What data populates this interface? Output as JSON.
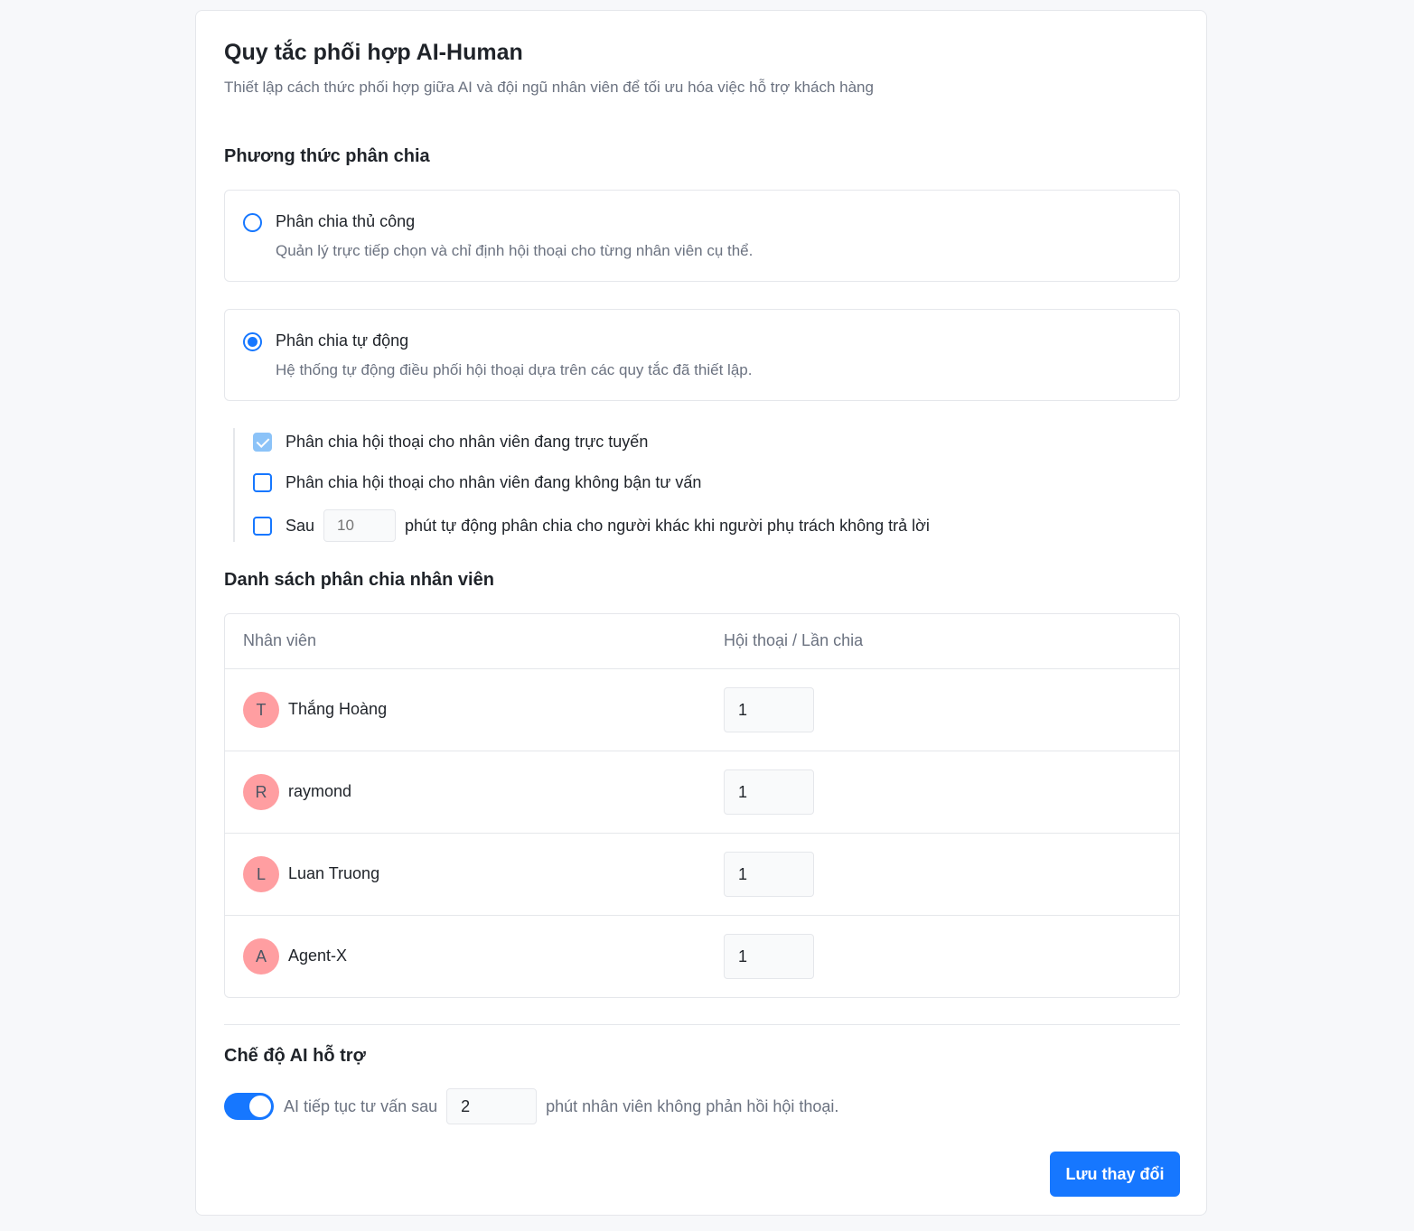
{
  "header": {
    "title": "Quy tắc phối hợp AI-Human",
    "subtitle": "Thiết lập cách thức phối hợp giữa AI và đội ngũ nhân viên để tối ưu hóa việc hỗ trợ khách hàng"
  },
  "distribution": {
    "section_title": "Phương thức phân chia",
    "options": [
      {
        "label": "Phân chia thủ công",
        "description": "Quản lý trực tiếp chọn và chỉ định hội thoại cho từng nhân viên cụ thể.",
        "selected": false
      },
      {
        "label": "Phân chia tự động",
        "description": "Hệ thống tự động điều phối hội thoại dựa trên các quy tắc đã thiết lập.",
        "selected": true
      }
    ],
    "auto_rules": [
      {
        "label": "Phân chia hội thoại cho nhân viên đang trực tuyến",
        "checked": true
      },
      {
        "label": "Phân chia hội thoại cho nhân viên đang không bận tư vấn",
        "checked": false
      }
    ],
    "timeout_rule": {
      "prefix": "Sau",
      "placeholder": "10",
      "suffix": "phút tự động phân chia cho người khác khi người phụ trách không trả lời",
      "checked": false
    }
  },
  "staff": {
    "section_title": "Danh sách phân chia nhân viên",
    "columns": [
      "Nhân viên",
      "Hội thoại / Lần chia"
    ],
    "rows": [
      {
        "initial": "T",
        "name": "Thắng Hoàng",
        "value": "1"
      },
      {
        "initial": "R",
        "name": "raymond",
        "value": "1"
      },
      {
        "initial": "L",
        "name": "Luan Truong",
        "value": "1"
      },
      {
        "initial": "A",
        "name": "Agent-X",
        "value": "1"
      }
    ]
  },
  "ai_mode": {
    "section_title": "Chế độ AI hỗ trợ",
    "enabled": true,
    "prefix": "AI tiếp tục tư vấn sau",
    "value": "2",
    "suffix": "phút nhân viên không phản hồi hội thoại."
  },
  "actions": {
    "save_label": "Lưu thay đổi"
  },
  "colors": {
    "accent": "#1677ff",
    "avatar": "#ff9ea1",
    "checked_box": "#8cc3f8"
  }
}
